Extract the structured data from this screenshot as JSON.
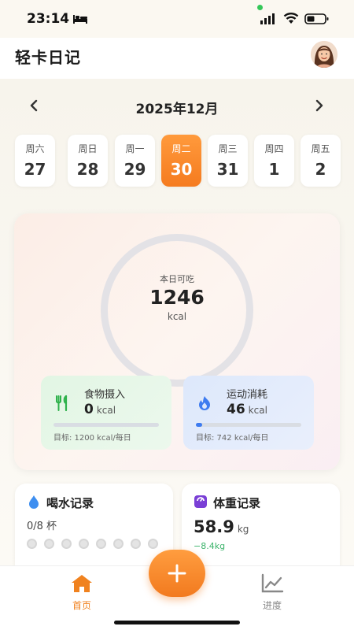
{
  "status_bar": {
    "time": "23:14"
  },
  "app": {
    "title": "轻卡日记"
  },
  "calendar": {
    "month": "2025年12月",
    "days": [
      {
        "dow": "周六",
        "num": "27"
      },
      {
        "dow": "周日",
        "num": "28"
      },
      {
        "dow": "周一",
        "num": "29"
      },
      {
        "dow": "周二",
        "num": "30",
        "selected": true
      },
      {
        "dow": "周三",
        "num": "31"
      },
      {
        "dow": "周四",
        "num": "1"
      },
      {
        "dow": "周五",
        "num": "2"
      }
    ]
  },
  "summary": {
    "label": "本日可吃",
    "value": "1246",
    "unit": "kcal",
    "food": {
      "title": "食物摄入",
      "value": "0",
      "unit": "kcal",
      "goal": "目标: 1200 kcal/每日",
      "progress": 0
    },
    "exercise": {
      "title": "运动消耗",
      "value": "46",
      "unit": "kcal",
      "goal": "目标: 742 kcal/每日",
      "progress": 0.062
    }
  },
  "water": {
    "title": "喝水记录",
    "count": "0/8 杯",
    "cups_total": 8,
    "cups_filled": 0
  },
  "weight": {
    "title": "体重记录",
    "value": "58.9",
    "unit": "kg",
    "delta": "−8.4kg"
  },
  "nav": {
    "home": "首页",
    "progress": "进度"
  },
  "colors": {
    "accent": "#f57b1f",
    "food_icon": "#2fb24c",
    "exercise_icon": "#3d7bf0",
    "water_icon": "#3d8ef0",
    "weight_icon": "#7a3fd6",
    "weight_delta": "#3bb36a"
  },
  "icons": {
    "bed": "bed-icon",
    "signal": "signal-icon",
    "wifi": "wifi-icon",
    "battery": "battery-icon",
    "prev": "chevron-left-icon",
    "next": "chevron-right-icon",
    "food": "utensils-icon",
    "exercise": "flame-icon",
    "water": "water-drop-icon",
    "weight": "scale-icon",
    "add": "plus-icon",
    "home": "home-icon",
    "progress": "chart-line-icon"
  }
}
